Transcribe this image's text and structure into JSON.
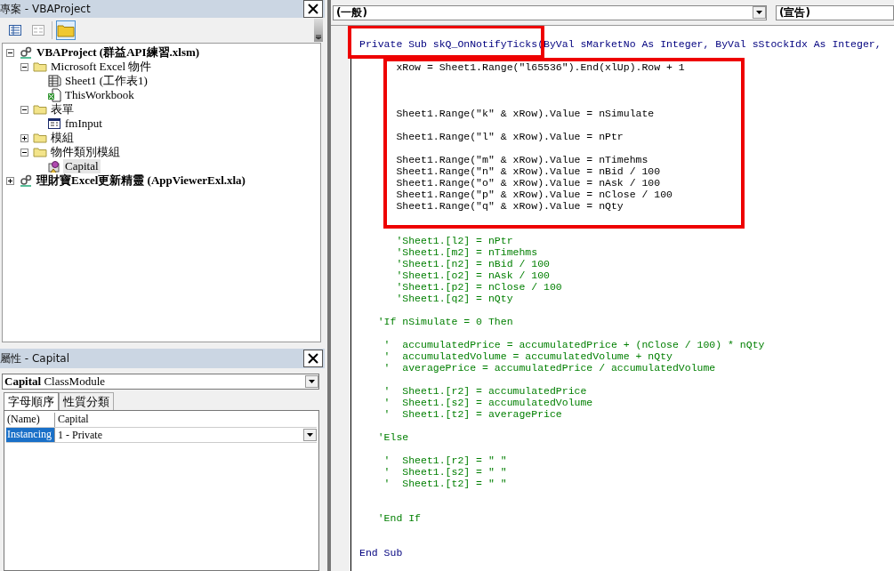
{
  "project_panel": {
    "title": "專案 - VBAProject",
    "tree": [
      {
        "label": "VBAProject (群益API練習.xlsm)",
        "kind": "project",
        "expanded": true,
        "selected": false,
        "children": [
          {
            "label": "Microsoft Excel 物件",
            "kind": "folder",
            "expanded": true,
            "selected": false,
            "children": [
              {
                "label": "Sheet1 (工作表1)",
                "kind": "sheet",
                "selected": false
              },
              {
                "label": "ThisWorkbook",
                "kind": "workbook",
                "selected": false
              }
            ]
          },
          {
            "label": "表單",
            "kind": "folder",
            "expanded": true,
            "selected": false,
            "children": [
              {
                "label": "fmInput",
                "kind": "form",
                "selected": false
              }
            ]
          },
          {
            "label": "模組",
            "kind": "folder",
            "expanded": false,
            "selected": false
          },
          {
            "label": "物件類別模組",
            "kind": "folder",
            "expanded": true,
            "selected": false,
            "children": [
              {
                "label": "Capital",
                "kind": "class",
                "selected": true
              }
            ]
          }
        ]
      },
      {
        "label": "理財寶Excel更新精靈 (AppViewerExl.xla)",
        "kind": "project",
        "expanded": false,
        "selected": false
      }
    ]
  },
  "properties_panel": {
    "title": "屬性 - Capital",
    "object_name": "Capital",
    "object_type": "ClassModule",
    "tabs": [
      {
        "label": "字母順序",
        "selected": true
      },
      {
        "label": "性質分類",
        "selected": false
      }
    ],
    "rows": [
      {
        "name": "(Name)",
        "value": "Capital",
        "kind": "text",
        "selected": false
      },
      {
        "name": "Instancing",
        "value": "1 - Private",
        "kind": "dropdown",
        "selected": true
      }
    ]
  },
  "editor": {
    "object_combo": "(一般)",
    "procedure_combo": "(宣告)",
    "lines": [
      {
        "kind": "keyword",
        "text": "Private Sub skQ_OnNotifyTicks(ByVal sMarketNo As Integer, ByVal sStockIdx As Integer,"
      },
      {
        "kind": "blank"
      },
      {
        "kind": "code",
        "text": "      xRow = Sheet1.Range(\"l65536\").End(xlUp).Row + 1"
      },
      {
        "kind": "blank"
      },
      {
        "kind": "blank"
      },
      {
        "kind": "blank"
      },
      {
        "kind": "code",
        "text": "      Sheet1.Range(\"k\" & xRow).Value = nSimulate"
      },
      {
        "kind": "blank"
      },
      {
        "kind": "code",
        "text": "      Sheet1.Range(\"l\" & xRow).Value = nPtr"
      },
      {
        "kind": "blank"
      },
      {
        "kind": "code",
        "text": "      Sheet1.Range(\"m\" & xRow).Value = nTimehms"
      },
      {
        "kind": "code",
        "text": "      Sheet1.Range(\"n\" & xRow).Value = nBid / 100"
      },
      {
        "kind": "code",
        "text": "      Sheet1.Range(\"o\" & xRow).Value = nAsk / 100"
      },
      {
        "kind": "code",
        "text": "      Sheet1.Range(\"p\" & xRow).Value = nClose / 100"
      },
      {
        "kind": "code",
        "text": "      Sheet1.Range(\"q\" & xRow).Value = nQty"
      },
      {
        "kind": "blank"
      },
      {
        "kind": "blank"
      },
      {
        "kind": "comment",
        "text": "      'Sheet1.[l2] = nPtr"
      },
      {
        "kind": "comment",
        "text": "      'Sheet1.[m2] = nTimehms"
      },
      {
        "kind": "comment",
        "text": "      'Sheet1.[n2] = nBid / 100"
      },
      {
        "kind": "comment",
        "text": "      'Sheet1.[o2] = nAsk / 100"
      },
      {
        "kind": "comment",
        "text": "      'Sheet1.[p2] = nClose / 100"
      },
      {
        "kind": "comment",
        "text": "      'Sheet1.[q2] = nQty"
      },
      {
        "kind": "blank"
      },
      {
        "kind": "comment",
        "text": "   'If nSimulate = 0 Then"
      },
      {
        "kind": "blank"
      },
      {
        "kind": "comment",
        "text": "    '  accumulatedPrice = accumulatedPrice + (nClose / 100) * nQty"
      },
      {
        "kind": "comment",
        "text": "    '  accumulatedVolume = accumulatedVolume + nQty"
      },
      {
        "kind": "comment",
        "text": "    '  averagePrice = accumulatedPrice / accumulatedVolume"
      },
      {
        "kind": "blank"
      },
      {
        "kind": "comment",
        "text": "    '  Sheet1.[r2] = accumulatedPrice"
      },
      {
        "kind": "comment",
        "text": "    '  Sheet1.[s2] = accumulatedVolume"
      },
      {
        "kind": "comment",
        "text": "    '  Sheet1.[t2] = averagePrice"
      },
      {
        "kind": "blank"
      },
      {
        "kind": "comment",
        "text": "   'Else"
      },
      {
        "kind": "blank"
      },
      {
        "kind": "comment",
        "text": "    '  Sheet1.[r2] = \" \""
      },
      {
        "kind": "comment",
        "text": "    '  Sheet1.[s2] = \" \""
      },
      {
        "kind": "comment",
        "text": "    '  Sheet1.[t2] = \" \""
      },
      {
        "kind": "blank"
      },
      {
        "kind": "blank"
      },
      {
        "kind": "comment",
        "text": "   'End If"
      },
      {
        "kind": "blank"
      },
      {
        "kind": "blank"
      },
      {
        "kind": "keyword",
        "text": "End Sub"
      }
    ]
  }
}
